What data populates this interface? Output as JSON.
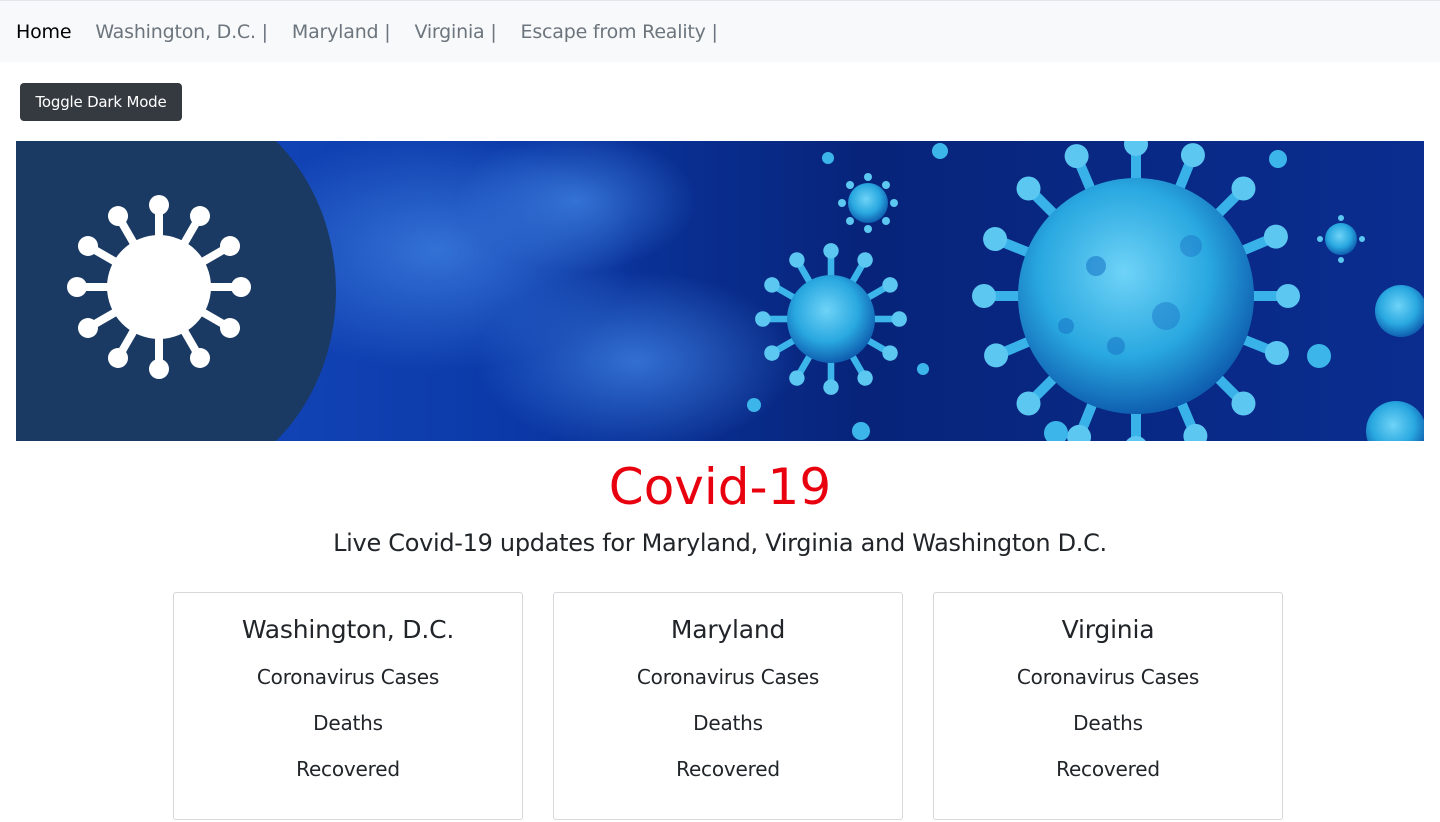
{
  "nav": {
    "home": "Home",
    "items": [
      {
        "label": "Washington, D.C. |"
      },
      {
        "label": "Maryland |"
      },
      {
        "label": "Virginia |"
      },
      {
        "label": "Escape from Reality |"
      }
    ]
  },
  "toggle_button": "Toggle Dark Mode",
  "banner": {
    "icon": "virus-icon",
    "colors": {
      "panel": "#1b3a63",
      "background": "#0a2a8a",
      "virus": "#29a8e0"
    }
  },
  "main": {
    "title": "Covid-19",
    "title_color": "#e8000f",
    "subtitle": "Live Covid-19 updates for Maryland, Virginia and Washington D.C."
  },
  "cards": [
    {
      "name": "Washington, D.C.",
      "cases_label": "Coronavirus Cases",
      "deaths_label": "Deaths",
      "recovered_label": "Recovered"
    },
    {
      "name": "Maryland",
      "cases_label": "Coronavirus Cases",
      "deaths_label": "Deaths",
      "recovered_label": "Recovered"
    },
    {
      "name": "Virginia",
      "cases_label": "Coronavirus Cases",
      "deaths_label": "Deaths",
      "recovered_label": "Recovered"
    }
  ]
}
